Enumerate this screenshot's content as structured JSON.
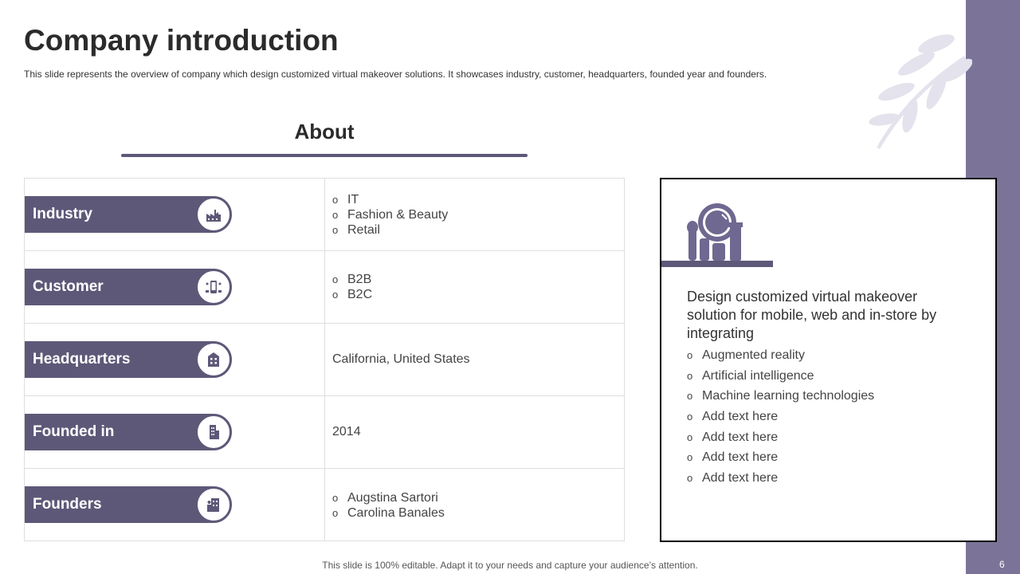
{
  "slide": {
    "title": "Company introduction",
    "subtitle": "This slide represents the overview of company which design customized virtual makeover solutions. It showcases industry, customer, headquarters, founded year and founders.",
    "footer": "This slide is 100% editable. Adapt it to your needs and capture your audience’s attention.",
    "page_number": "6",
    "accent_color": "#5e5878",
    "band_color": "#7b7498"
  },
  "about": {
    "heading": "About",
    "rows": [
      {
        "label": "Industry",
        "icon": "factory-icon",
        "values": [
          "IT",
          "Fashion & Beauty",
          "Retail"
        ]
      },
      {
        "label": "Customer",
        "icon": "customer-phone-icon",
        "values": [
          "B2B",
          "B2C"
        ]
      },
      {
        "label": "Headquarters",
        "icon": "building-icon",
        "value": "California, United States"
      },
      {
        "label": "Founded in",
        "icon": "office-tower-icon",
        "value": "2014"
      },
      {
        "label": "Founders",
        "icon": "founders-building-icon",
        "values": [
          "Augstina Sartori",
          "Carolina Banales"
        ]
      }
    ]
  },
  "card": {
    "icon": "makeup-mirror-icon",
    "description": "Design customized virtual makeover solution for mobile, web and in-store by integrating",
    "items": [
      "Augmented reality",
      "Artificial intelligence",
      "Machine learning technologies",
      "Add text here",
      "Add text here",
      "Add text here",
      "Add text here"
    ]
  },
  "bullet_glyph": "o"
}
